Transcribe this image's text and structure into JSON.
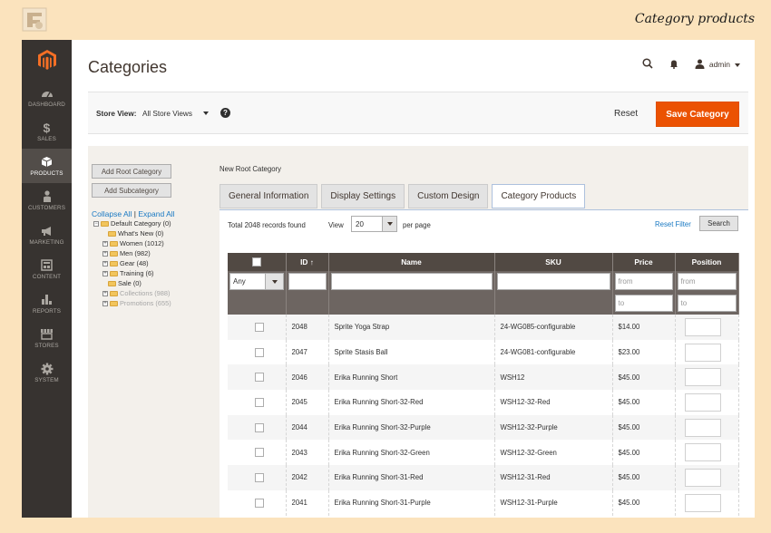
{
  "caption": "Category products",
  "sidebar": {
    "items": [
      {
        "label": "DASHBOARD",
        "icon": "dashboard-icon"
      },
      {
        "label": "SALES",
        "icon": "dollar-icon"
      },
      {
        "label": "PRODUCTS",
        "icon": "cube-icon"
      },
      {
        "label": "CUSTOMERS",
        "icon": "person-icon"
      },
      {
        "label": "MARKETING",
        "icon": "megaphone-icon"
      },
      {
        "label": "CONTENT",
        "icon": "layout-icon"
      },
      {
        "label": "REPORTS",
        "icon": "bar-chart-icon"
      },
      {
        "label": "STORES",
        "icon": "storefront-icon"
      },
      {
        "label": "SYSTEM",
        "icon": "gear-icon"
      }
    ],
    "active": "PRODUCTS"
  },
  "header": {
    "title": "Categories",
    "user": "admin"
  },
  "actionbar": {
    "store_view_label": "Store View:",
    "store_view_value": "All Store Views",
    "help": "?",
    "reset": "Reset",
    "save": "Save Category"
  },
  "tree": {
    "add_root": "Add Root Category",
    "add_sub": "Add Subcategory",
    "collapse_all": "Collapse All",
    "separator": "|",
    "expand_all": "Expand All",
    "root": "Default Category (0)",
    "children": [
      {
        "label": "What's New (0)",
        "expander": false,
        "muted": false
      },
      {
        "label": "Women (1012)",
        "expander": true,
        "muted": false
      },
      {
        "label": "Men (982)",
        "expander": true,
        "muted": false
      },
      {
        "label": "Gear (48)",
        "expander": true,
        "muted": false
      },
      {
        "label": "Training (6)",
        "expander": true,
        "muted": false
      },
      {
        "label": "Sale (0)",
        "expander": false,
        "muted": false
      },
      {
        "label": "Collections (988)",
        "expander": true,
        "muted": true
      },
      {
        "label": "Promotions (655)",
        "expander": true,
        "muted": true
      }
    ]
  },
  "category": {
    "title": "New Root Category",
    "tabs": [
      "General Information",
      "Display Settings",
      "Custom Design",
      "Category Products"
    ],
    "active_tab": "Category Products"
  },
  "grid": {
    "records": "Total 2048 records found",
    "view_label": "View",
    "per_page_value": "20",
    "per_page_label": "per page",
    "reset_filter": "Reset Filter",
    "search": "Search",
    "columns": [
      "",
      "ID",
      "Name",
      "SKU",
      "Price",
      "Position"
    ],
    "sort_arrow": "↑",
    "filter_any": "Any",
    "filter_from": "from",
    "filter_to": "to",
    "rows": [
      {
        "id": "2048",
        "name": "Sprite Yoga Strap",
        "sku": "24-WG085-configurable",
        "price": "$14.00"
      },
      {
        "id": "2047",
        "name": "Sprite Stasis Ball",
        "sku": "24-WG081-configurable",
        "price": "$23.00"
      },
      {
        "id": "2046",
        "name": "Erika Running Short",
        "sku": "WSH12",
        "price": "$45.00"
      },
      {
        "id": "2045",
        "name": "Erika Running Short-32-Red",
        "sku": "WSH12-32-Red",
        "price": "$45.00"
      },
      {
        "id": "2044",
        "name": "Erika Running Short-32-Purple",
        "sku": "WSH12-32-Purple",
        "price": "$45.00"
      },
      {
        "id": "2043",
        "name": "Erika Running Short-32-Green",
        "sku": "WSH12-32-Green",
        "price": "$45.00"
      },
      {
        "id": "2042",
        "name": "Erika Running Short-31-Red",
        "sku": "WSH12-31-Red",
        "price": "$45.00"
      },
      {
        "id": "2041",
        "name": "Erika Running Short-31-Purple",
        "sku": "WSH12-31-Purple",
        "price": "$45.00"
      }
    ]
  },
  "colors": {
    "sidebar": "#373330",
    "accent": "#eb5202",
    "grid_header": "#514943",
    "link": "#1979c3"
  }
}
